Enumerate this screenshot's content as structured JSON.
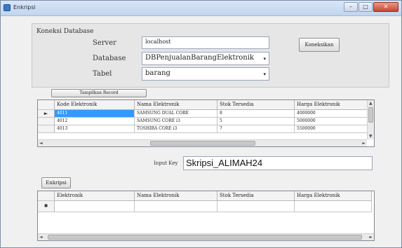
{
  "window": {
    "title": "Enkripsi",
    "controls": {
      "minimize": "–",
      "maximize": "□",
      "close": "✕"
    }
  },
  "connection": {
    "group_title": "Koneksi Database",
    "server_label": "Server",
    "server_value": "localhost",
    "database_label": "Database",
    "database_value": "DBPenjualanBarangElektronik",
    "table_label": "Tabel",
    "table_value": "barang",
    "connect_button": "Koneksikan"
  },
  "show_button": "Tampilkan Record",
  "source_grid": {
    "columns": [
      "Kode Elektronik",
      "Nama Elektronik",
      "Stok Tersedia",
      "Harga Elektronik"
    ],
    "rows": [
      [
        "4011",
        "SAMSUNG DUAL CORE",
        "8",
        "4000000"
      ],
      [
        "4012",
        "SAMSUNG CORE i3",
        "5",
        "5000000"
      ],
      [
        "4013",
        "TOSHIBA CORE i3",
        "7",
        "5500000"
      ]
    ],
    "current_row_marker": "►"
  },
  "key_input": {
    "label": "Input Key",
    "value": "Skripsi_ALIMAH24"
  },
  "encrypt_button": "Enkripsi",
  "result_grid": {
    "columns": [
      "Elektronik",
      "Nama Elektronik",
      "Stok Tersedia",
      "Harga Elektronik"
    ],
    "new_row_marker": "✱"
  },
  "icons": {
    "combo_arrow": "▾",
    "scroll_up": "▲",
    "scroll_down": "▼",
    "scroll_left": "◄",
    "scroll_right": "►"
  },
  "colors": {
    "selection": "#3399ff",
    "titlebar": "#c2d5ee"
  }
}
